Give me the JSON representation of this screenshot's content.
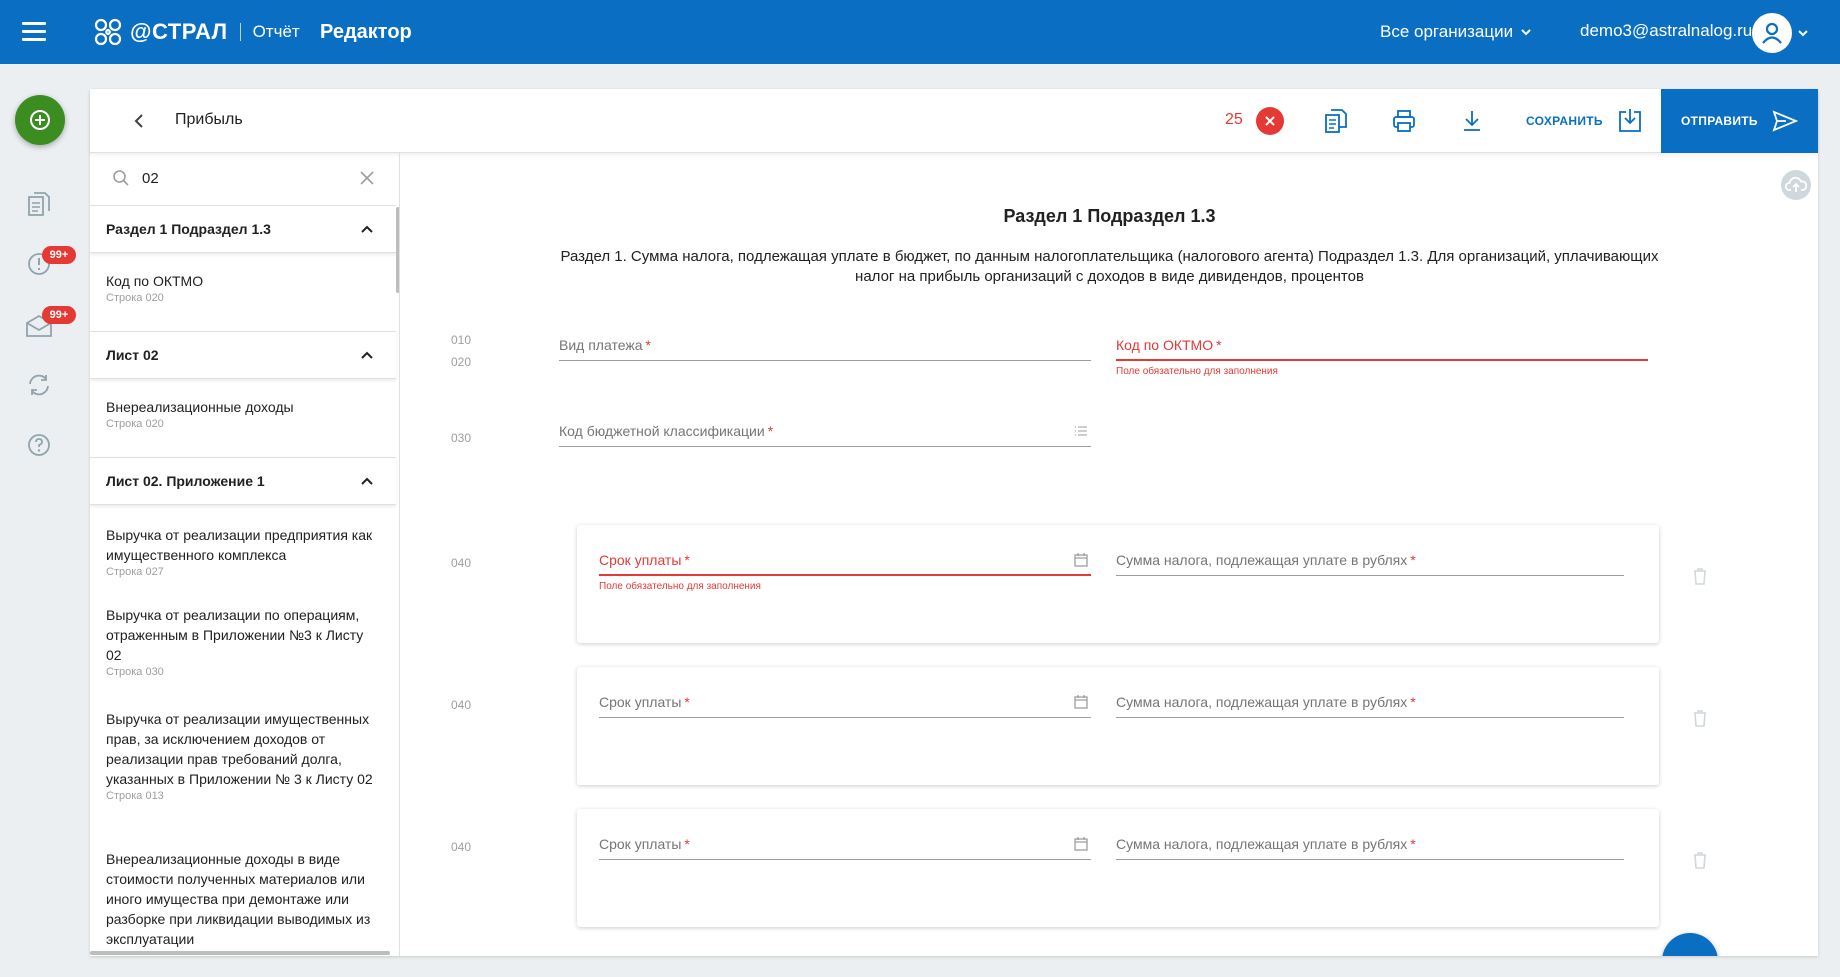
{
  "header": {
    "logo_text": "@СТРАЛ",
    "logo_sub": "Отчёт",
    "app_title": "Редактор",
    "org_select": "Все организации",
    "user_email": "demo3@astralnalog.ru"
  },
  "rail": {
    "badges": [
      "99+",
      "99+"
    ]
  },
  "toolbar": {
    "doc_title": "Прибыль",
    "error_count": "25",
    "save_label": "СОХРАНИТЬ",
    "send_label": "ОТПРАВИТЬ"
  },
  "sidebar": {
    "search_value": "02",
    "sections": [
      {
        "title": "Раздел 1 Подраздел 1.3",
        "items": [
          {
            "title": "Код по ОКТМО",
            "line": "Строка 020"
          }
        ]
      },
      {
        "title": "Лист 02",
        "items": [
          {
            "title": "Внереализационные доходы",
            "line": "Строка 020"
          }
        ]
      },
      {
        "title": "Лист 02. Приложение 1",
        "items": [
          {
            "title": "Выручка от реализации предприятия как имущественного комплекса",
            "line": "Строка 027"
          },
          {
            "title": "Выручка от реализации по операциям, отраженным в Приложении №3 к Листу 02",
            "line": "Строка 030"
          },
          {
            "title": "Выручка от реализации имущественных прав, за исключением доходов от реализации прав требований долга, указанных в Приложении № 3 к Листу 02",
            "line": "Строка 013"
          },
          {
            "title": "Внереализационные доходы в виде стоимости полученных материалов или иного имущества при демонтаже или разборке при ликвидации выводимых из эксплуатации",
            "line": ""
          }
        ]
      }
    ]
  },
  "form": {
    "title": "Раздел 1 Подраздел 1.3",
    "description": "Раздел 1. Сумма налога, подлежащая уплате в бюджет, по данным налогоплательщика (налогового агента) Подраздел 1.3. Для организаций, уплачивающих налог на прибыль организаций с доходов в виде дивидендов, процентов",
    "line_numbers": {
      "l010": "010",
      "l020": "020",
      "l030": "030",
      "l040": "040"
    },
    "fields": {
      "payment_type": "Вид платежа",
      "oktmo": "Код по ОКТМО",
      "kbk": "Код бюджетной классификации",
      "due_date": "Срок уплаты",
      "tax_amount": "Сумма налога, подлежащая уплате в рублях"
    },
    "required_mark": "*",
    "error_text": "Поле обязательно для заполнения"
  },
  "colors": {
    "primary": "#0a6fc2",
    "error": "#e53935",
    "success": "#3b8d22"
  }
}
